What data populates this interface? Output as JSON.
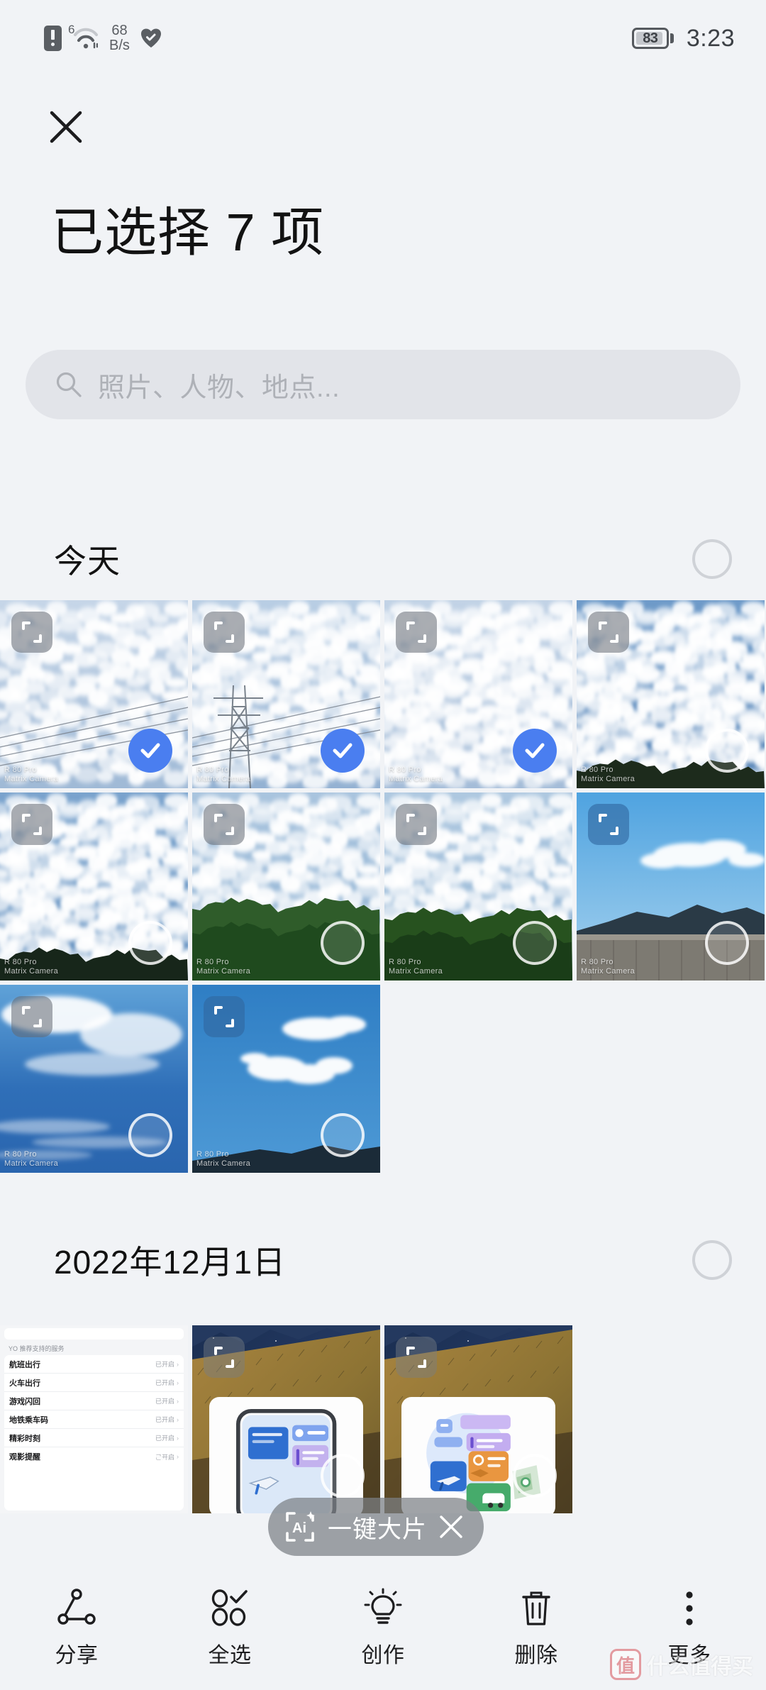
{
  "statusbar": {
    "sim_icon": "sim-alert-icon",
    "wifi_generation": "6",
    "wifi_icon": "wifi-icon",
    "network_speed": "68\nB/s",
    "network_speed_value": "68",
    "network_speed_unit": "B/s",
    "health_icon": "heart-shield-icon",
    "battery_percent": "83",
    "time": "3:23"
  },
  "header": {
    "close_icon": "close-icon",
    "title": "已选择 7 项"
  },
  "search": {
    "icon": "search-icon",
    "placeholder": "照片、人物、地点..."
  },
  "sections": [
    {
      "title": "今天",
      "select_all_state": "unchecked",
      "photos": [
        {
          "name": "photo-clouds-powerline-1",
          "selected": true,
          "badge": "screenshot-badge-icon",
          "badge_style": "gray",
          "watermark": "R 80 Pro\nMatrix Camera",
          "kind": "clouds-wires"
        },
        {
          "name": "photo-clouds-pylon",
          "selected": true,
          "badge": "screenshot-badge-icon",
          "badge_style": "gray",
          "watermark": "R 80 Pro\nMatrix Camera",
          "kind": "clouds-pylon"
        },
        {
          "name": "photo-clouds-dense",
          "selected": true,
          "badge": "screenshot-badge-icon",
          "badge_style": "gray",
          "watermark": "R 80 Pro\nMatrix Camera",
          "kind": "clouds-dense"
        },
        {
          "name": "photo-clouds-ripple",
          "selected": false,
          "badge": "screenshot-badge-icon",
          "badge_style": "gray",
          "watermark": "R 80 Pro\nMatrix Camera",
          "kind": "clouds-ripple"
        },
        {
          "name": "photo-clouds-treeline-1",
          "selected": false,
          "badge": "screenshot-badge-icon",
          "badge_style": "gray",
          "watermark": "R 80 Pro\nMatrix Camera",
          "kind": "clouds-treeline-dark"
        },
        {
          "name": "photo-clouds-trees",
          "selected": false,
          "badge": "screenshot-badge-icon",
          "badge_style": "gray",
          "watermark": "R 80 Pro\nMatrix Camera",
          "kind": "clouds-trees"
        },
        {
          "name": "photo-clouds-treeline-2",
          "selected": false,
          "badge": "screenshot-badge-icon",
          "badge_style": "gray",
          "watermark": "R 80 Pro\nMatrix Camera",
          "kind": "clouds-trees2"
        },
        {
          "name": "photo-bluesky-ridge",
          "selected": false,
          "badge": "screenshot-badge-icon",
          "badge_style": "blue",
          "watermark": "R 80 Pro\nMatrix Camera",
          "kind": "bluesky-ridge"
        },
        {
          "name": "photo-bluesky-wispy",
          "selected": false,
          "badge": "screenshot-badge-icon",
          "badge_style": "gray",
          "watermark": "R 80 Pro\nMatrix Camera",
          "kind": "bluesky-wispy"
        },
        {
          "name": "photo-bluesky-cloud",
          "selected": false,
          "badge": "screenshot-badge-icon",
          "badge_style": "blue",
          "watermark": "R 80 Pro\nMatrix Camera",
          "kind": "bluesky-cloud"
        }
      ]
    },
    {
      "title": "2022年12月1日",
      "select_all_state": "unchecked",
      "photos": [
        {
          "name": "screenshot-suggested-services",
          "selected": false,
          "badge": "",
          "badge_style": "gray",
          "watermark": "",
          "kind": "shot-settings"
        },
        {
          "name": "screenshot-promo-phone",
          "selected": false,
          "badge": "screenshot-badge-icon",
          "badge_style": "white",
          "watermark": "",
          "kind": "shot-promo-phone"
        },
        {
          "name": "screenshot-promo-cards",
          "selected": false,
          "badge": "screenshot-badge-icon",
          "badge_style": "white",
          "watermark": "",
          "kind": "shot-promo-cards"
        }
      ]
    }
  ],
  "screenshot_thumb": {
    "caption": "YO 推荐支持的服务",
    "rows": [
      {
        "label": "航班出行",
        "status": "已开启",
        "chevron": "›"
      },
      {
        "label": "火车出行",
        "status": "已开启",
        "chevron": "›"
      },
      {
        "label": "游戏闪回",
        "status": "已开启",
        "chevron": "›"
      },
      {
        "label": "地铁乘车码",
        "status": "已开启",
        "chevron": "›"
      },
      {
        "label": "精彩时刻",
        "status": "已开启",
        "chevron": "›"
      },
      {
        "label": "观影提醒",
        "status": "已开启",
        "chevron": "›"
      }
    ]
  },
  "ai_pill": {
    "icon": "ai-sparkle-icon",
    "label": "一键大片",
    "close_icon": "close-icon"
  },
  "toolbar": [
    {
      "name": "share",
      "icon": "share-icon",
      "label": "分享"
    },
    {
      "name": "select-all",
      "icon": "select-all-icon",
      "label": "全选"
    },
    {
      "name": "create",
      "icon": "lightbulb-icon",
      "label": "创作"
    },
    {
      "name": "delete",
      "icon": "trash-icon",
      "label": "删除"
    },
    {
      "name": "more",
      "icon": "more-dots-icon",
      "label": "更多"
    }
  ],
  "watermark": {
    "badge": "值",
    "text": "什么值得买"
  },
  "colors": {
    "background": "#f1f3f6",
    "accent_selected": "#4a7ef0",
    "text_primary": "#121212",
    "text_muted": "#aeb1b7",
    "search_bg": "#e2e4e9"
  }
}
